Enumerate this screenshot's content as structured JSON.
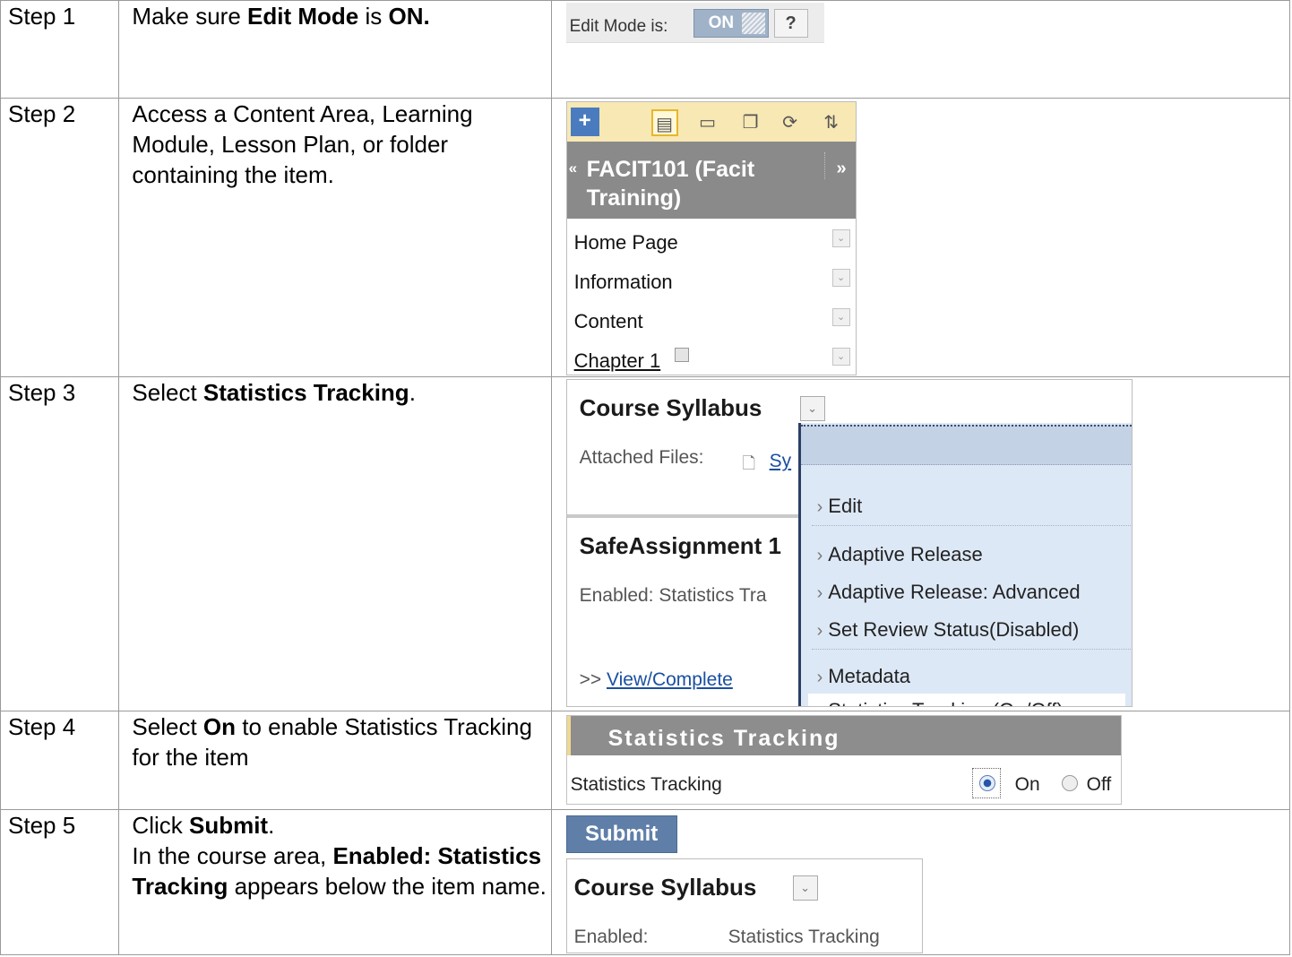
{
  "steps": [
    {
      "label": "Step 1",
      "instruction": {
        "a": "Make sure ",
        "b": "Edit Mode",
        "c": " is ",
        "d": "ON."
      }
    },
    {
      "label": "Step 2",
      "instruction": {
        "a": "Access a Content Area, Learning Module, Lesson Plan, or folder containing the item."
      }
    },
    {
      "label": "Step 3",
      "instruction": {
        "a": "Select ",
        "b": "Statistics Tracking",
        "c": "."
      }
    },
    {
      "label": "Step 4",
      "instruction": {
        "a": "Select ",
        "b": "On",
        "c": " to enable Statistics Tracking for the item"
      }
    },
    {
      "label": "Step 5",
      "instruction": {
        "a": "Click ",
        "b": "Submit",
        "c": ".",
        "d": "In the course area, ",
        "e": "Enabled: Statistics Tracking",
        "f": " appears below the item name."
      }
    }
  ],
  "edit_mode": {
    "label": "Edit Mode is:",
    "state": "ON",
    "help": "?"
  },
  "course_menu": {
    "title": "FACIT101 (Facit Training)",
    "items": [
      "Home Page",
      "Information",
      "Content",
      "Chapter 1"
    ],
    "icons": [
      "plus-icon",
      "list-icon",
      "folder-icon",
      "window-icon",
      "refresh-icon",
      "sort-icon"
    ]
  },
  "context_menu": {
    "item_title": "Course Syllabus",
    "attached_label": "Attached Files:",
    "attached_file": "Sy",
    "item2_title": "SafeAssignment 1",
    "enabled_text": "Enabled:  Statistics Tra",
    "view_prefix": ">>",
    "view_link": "View/Complete",
    "menu_items": [
      "Edit",
      "Adaptive Release",
      "Adaptive Release: Advanced",
      "Set Review Status(Disabled)",
      "Metadata",
      "Statistics Tracking (On/Off)"
    ]
  },
  "stats_form": {
    "header": "Statistics Tracking",
    "field_label": "Statistics Tracking",
    "on": "On",
    "off": "Off",
    "selected": "On"
  },
  "result": {
    "submit": "Submit",
    "title": "Course Syllabus",
    "enabled_label": "Enabled:",
    "enabled_value": "Statistics Tracking"
  }
}
